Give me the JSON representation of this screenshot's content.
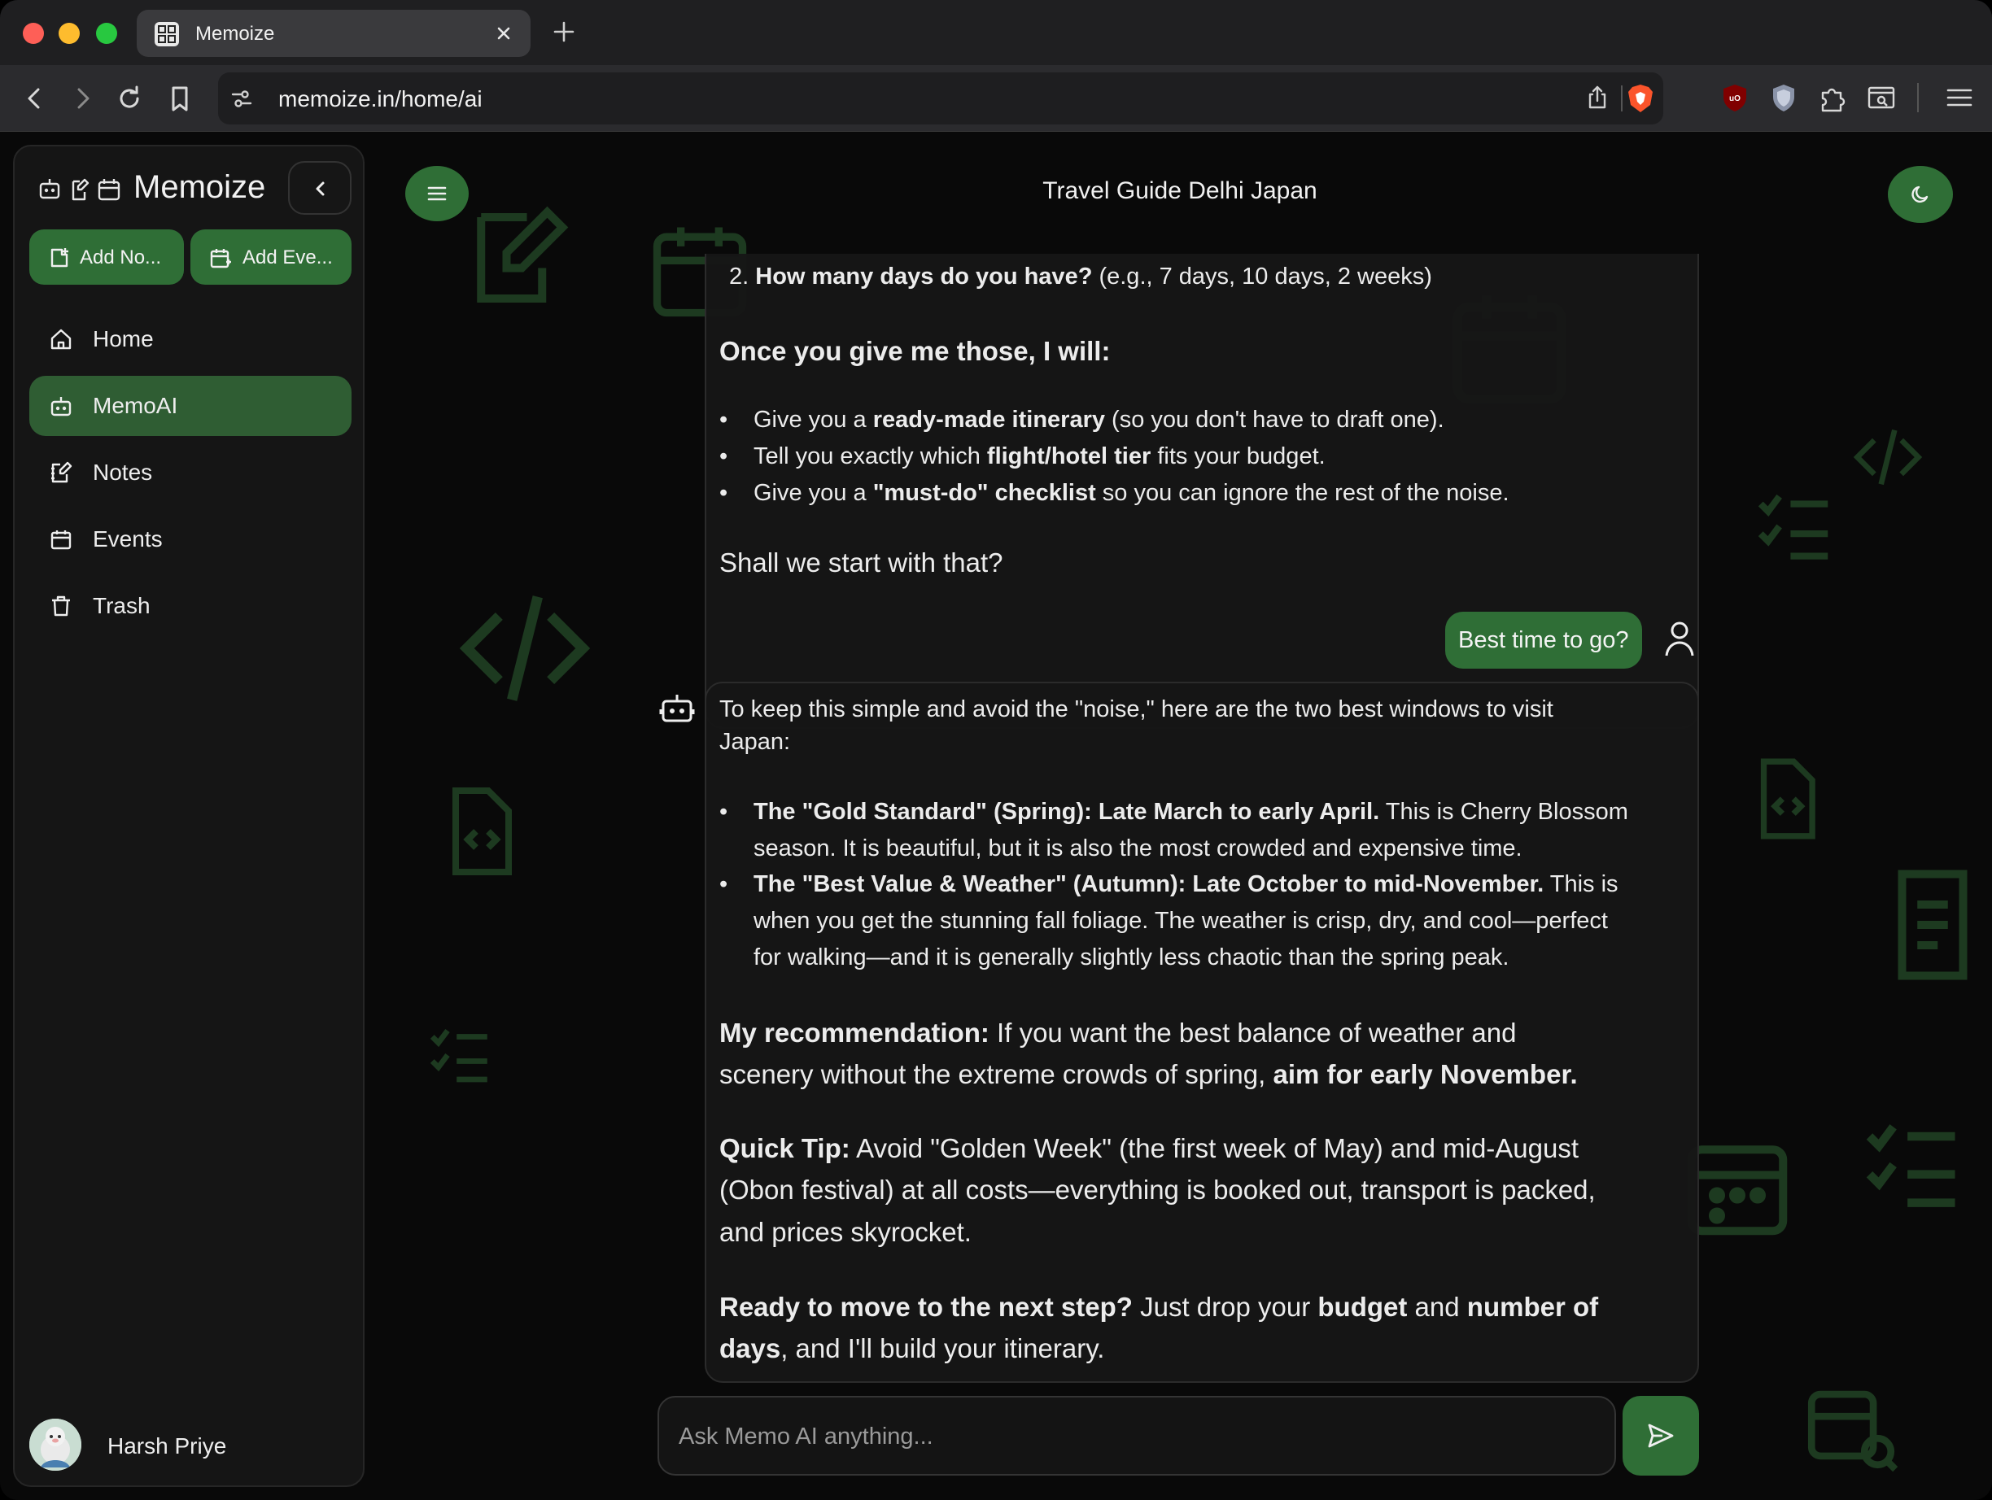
{
  "browser": {
    "tab_title": "Memoize",
    "url": "memoize.in/home/ai",
    "icons": [
      "back-icon",
      "forward-icon",
      "reload-icon",
      "bookmark-icon",
      "site-settings-icon",
      "share-icon",
      "brave-shields-icon",
      "ublock-icon",
      "privacy-shield-icon",
      "extensions-icon",
      "reader-mode-icon",
      "menu-icon"
    ]
  },
  "sidebar": {
    "brand": "Memoize",
    "add_note": "Add No...",
    "add_event": "Add Eve...",
    "nav": [
      {
        "label": "Home",
        "icon": "home-icon",
        "active": false
      },
      {
        "label": "MemoAI",
        "icon": "robot-icon",
        "active": true
      },
      {
        "label": "Notes",
        "icon": "notes-icon",
        "active": false
      },
      {
        "label": "Events",
        "icon": "calendar-icon",
        "active": false
      },
      {
        "label": "Trash",
        "icon": "trash-icon",
        "active": false
      }
    ],
    "user_name": "Harsh Priye"
  },
  "chat": {
    "title": "Travel Guide Delhi Japan",
    "msg1": {
      "q2_num": "2.",
      "q2_bold": "How many days do you have?",
      "q2_rest": "(e.g., 7 days, 10 days, 2 weeks)",
      "heading": "Once you give me those, I will:",
      "b1_pre": "Give you a ",
      "b1_bold": "ready-made itinerary",
      "b1_post": " (so you don't have to draft one).",
      "b2_pre": "Tell you exactly which ",
      "b2_bold": "flight/hotel tier",
      "b2_post": " fits your budget.",
      "b3_pre": "Give you a ",
      "b3_bold": "\"must-do\" checklist",
      "b3_post": " so you can ignore the rest of the noise.",
      "closing": "Shall we start with that?"
    },
    "user_msg": "Best time to go?",
    "msg2": {
      "intro_1": "To keep this simple and avoid the \"noise,\" here are the two best windows to visit",
      "intro_2": "Japan:",
      "w1_bold": "The \"Gold Standard\" (Spring): Late March to early April.",
      "w1_rest1": " This is Cherry Blossom",
      "w1_rest2": "season. It is beautiful, but it is also the most crowded and expensive time.",
      "w2_bold": "The \"Best Value & Weather\" (Autumn): Late October to mid-November.",
      "w2_rest1": " This is",
      "w2_rest2": "when you get the stunning fall foliage. The weather is crisp, dry, and cool—perfect",
      "w2_rest3": "for walking—and it is generally slightly less chaotic than the spring peak.",
      "rec_bold": "My recommendation:",
      "rec_rest1": " If you want the best balance of weather and",
      "rec_rest2": "scenery without the extreme crowds of spring, ",
      "rec_bold2": "aim for early November.",
      "tip_bold": "Quick Tip:",
      "tip_rest1": " Avoid \"Golden Week\" (the first week of May) and mid-August",
      "tip_rest2": "(Obon festival) at all costs—everything is booked out, transport is packed,",
      "tip_rest3": "and prices skyrocket.",
      "next_bold": "Ready to move to the next step?",
      "next_rest1": " Just drop your ",
      "next_budget": "budget",
      "next_and": " and ",
      "next_number": "number of",
      "next_days": "days",
      "next_rest2": ", and I'll build your itinerary."
    },
    "input_placeholder": "Ask Memo AI anything..."
  },
  "colors": {
    "accent": "#2f6e36",
    "active_nav": "#2f5d33",
    "background": "#090909"
  }
}
